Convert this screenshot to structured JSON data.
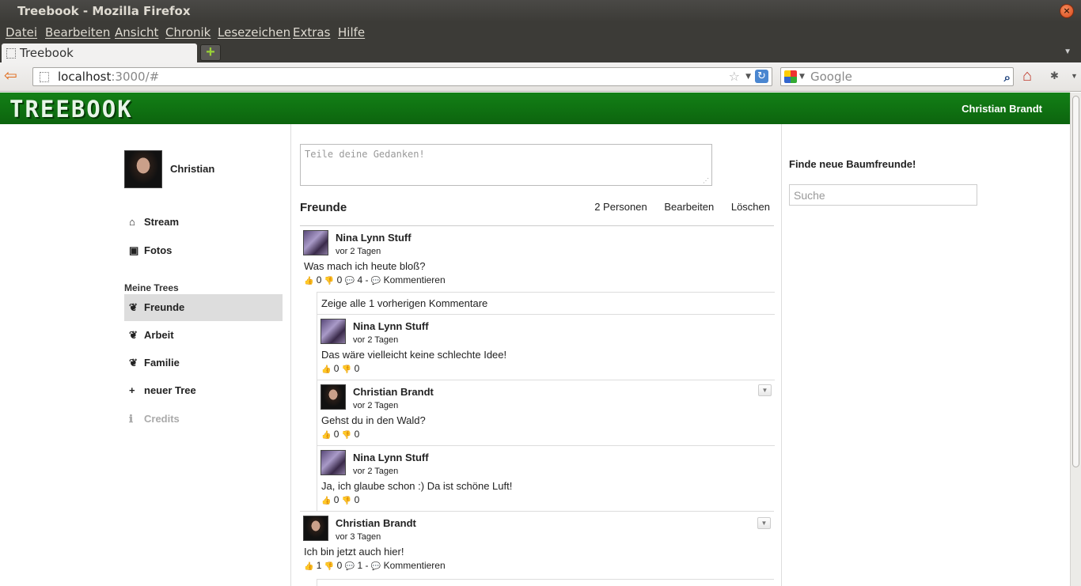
{
  "window": {
    "title": "Treebook - Mozilla Firefox",
    "close_icon": "×"
  },
  "menubar": [
    "Datei",
    "Bearbeiten",
    "Ansicht",
    "Chronik",
    "Lesezeichen",
    "Extras",
    "Hilfe"
  ],
  "tab": {
    "label": "Treebook",
    "new_tab": "+"
  },
  "nav": {
    "url_host": "localhost",
    "url_path": ":3000/#",
    "search_placeholder": "Google"
  },
  "site": {
    "logo": "TREEBOOK",
    "current_user": "Christian Brandt",
    "accent": "#138016"
  },
  "sidebar": {
    "profile_name": "Christian",
    "items": [
      {
        "label": "Stream",
        "icon": "home-icon"
      },
      {
        "label": "Fotos",
        "icon": "picture-icon"
      }
    ],
    "trees_heading": "Meine Trees",
    "trees": [
      {
        "label": "Freunde",
        "icon": "paw-icon"
      },
      {
        "label": "Arbeit",
        "icon": "paw-icon"
      },
      {
        "label": "Familie",
        "icon": "paw-icon"
      },
      {
        "label": "neuer Tree",
        "icon": "plus-icon"
      },
      {
        "label": "Credits",
        "icon": "info-icon"
      }
    ]
  },
  "composer": {
    "placeholder": "Teile deine Gedanken!"
  },
  "tree": {
    "title": "Freunde",
    "members": "2 Personen",
    "edit": "Bearbeiten",
    "delete": "Löschen"
  },
  "posts": [
    {
      "author": "Nina Lynn Stuff",
      "time": "vor 2 Tagen",
      "text": "Was mach ich heute bloß?",
      "likes": "0",
      "dislikes": "0",
      "comments": "4",
      "comment_label": "Kommentieren",
      "show_all": "Zeige alle 1 vorherigen Kommentare",
      "replies": [
        {
          "author": "Nina Lynn Stuff",
          "time": "vor 2 Tagen",
          "text": "Das wäre vielleicht keine schlechte Idee!",
          "likes": "0",
          "dislikes": "0"
        },
        {
          "author": "Christian Brandt",
          "time": "vor 2 Tagen",
          "text": "Gehst du in den Wald?",
          "likes": "0",
          "dislikes": "0"
        },
        {
          "author": "Nina Lynn Stuff",
          "time": "vor 2 Tagen",
          "text": "Ja, ich glaube schon :) Da ist schöne Luft!",
          "likes": "0",
          "dislikes": "0"
        }
      ]
    },
    {
      "author": "Christian Brandt",
      "time": "vor 3 Tagen",
      "text": "Ich bin jetzt auch hier!",
      "likes": "1",
      "dislikes": "0",
      "comments": "1",
      "comment_label": "Kommentieren"
    }
  ],
  "right": {
    "heading": "Finde neue Baumfreunde!",
    "search_placeholder": "Suche"
  }
}
